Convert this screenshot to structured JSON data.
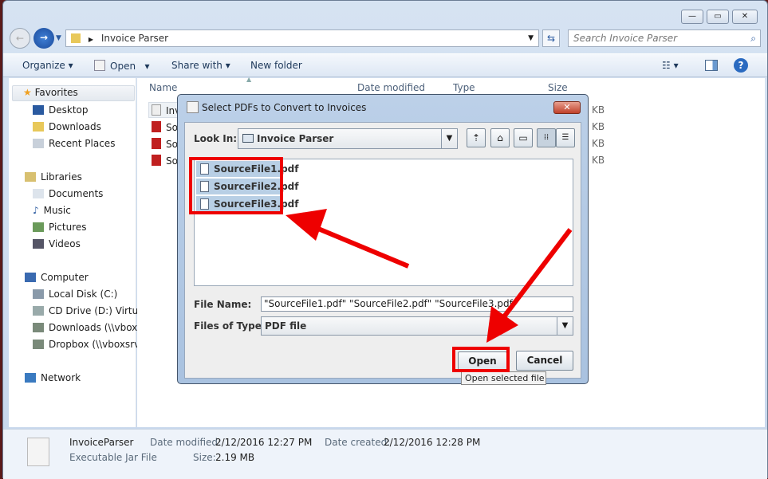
{
  "explorer": {
    "address": "Invoice Parser",
    "search_placeholder": "Search Invoice Parser",
    "toolbar": {
      "organize": "Organize",
      "open": "Open",
      "share_with": "Share with",
      "new_folder": "New folder"
    },
    "columns": [
      "Name",
      "Date modified",
      "Type",
      "Size"
    ],
    "files": [
      {
        "name": "Inv",
        "size": "KB"
      },
      {
        "name": "Sou",
        "size": "KB"
      },
      {
        "name": "Sou",
        "size": "KB"
      },
      {
        "name": "Sou",
        "size": "KB"
      }
    ],
    "nav": {
      "favorites": "Favorites",
      "desktop": "Desktop",
      "downloads": "Downloads",
      "recent": "Recent Places",
      "libraries": "Libraries",
      "documents": "Documents",
      "music": "Music",
      "pictures": "Pictures",
      "videos": "Videos",
      "computer": "Computer",
      "local_disk": "Local Disk (C:)",
      "cd_drive": "CD Drive (D:) Virtual",
      "downloads_net": "Downloads (\\\\vboxs",
      "dropbox": "Dropbox (\\\\vboxsrv)",
      "network": "Network"
    },
    "details": {
      "name": "InvoiceParser",
      "type": "Executable Jar File",
      "modified_label": "Date modified:",
      "modified": "2/12/2016 12:27 PM",
      "created_label": "Date created:",
      "created": "2/12/2016 12:28 PM",
      "size_label": "Size:",
      "size": "2.19 MB"
    }
  },
  "dialog": {
    "title": "Select PDFs to Convert to Invoices",
    "look_in_label": "Look In:",
    "look_in": "Invoice Parser",
    "files": [
      "SourceFile1.pdf",
      "SourceFile2.pdf",
      "SourceFile3.pdf"
    ],
    "file_name_label": "File Name:",
    "file_name": "\"SourceFile1.pdf\" \"SourceFile2.pdf\" \"SourceFile3.pdf\"",
    "file_type_label": "Files of Type:",
    "file_type": "PDF file",
    "open": "Open",
    "cancel": "Cancel",
    "tooltip": "Open selected file"
  },
  "colors": {
    "annotation": "#ee0000",
    "selection": "#b8cfe5"
  }
}
